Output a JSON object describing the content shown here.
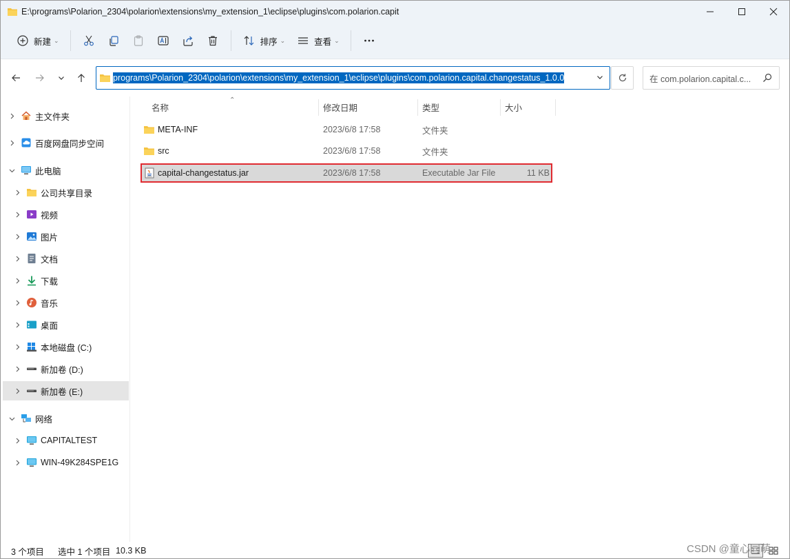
{
  "window": {
    "title": "E:\\programs\\Polarion_2304\\polarion\\extensions\\my_extension_1\\eclipse\\plugins\\com.polarion.capit",
    "controls": [
      "minimize-icon",
      "maximize-icon",
      "close-icon"
    ]
  },
  "toolbar": {
    "new_label": "新建",
    "sort_label": "排序",
    "view_label": "查看",
    "icons": [
      "cut-icon",
      "copy-icon",
      "paste-icon",
      "rename-icon",
      "share-icon",
      "delete-icon",
      "more-icon"
    ]
  },
  "address": {
    "path": "programs\\Polarion_2304\\polarion\\extensions\\my_extension_1\\eclipse\\plugins\\com.polarion.capital.changestatus_1.0.0",
    "search_placeholder": "在 com.polarion.capital.c..."
  },
  "sidebar": {
    "items": [
      {
        "label": "主文件夹",
        "icon": "home-icon"
      },
      {
        "label": "百度网盘同步空间",
        "icon": "cloud-sync-icon"
      },
      {
        "label": "此电脑",
        "icon": "computer-icon"
      },
      {
        "label": "公司共享目录",
        "icon": "folder-icon"
      },
      {
        "label": "视频",
        "icon": "video-icon"
      },
      {
        "label": "图片",
        "icon": "picture-icon"
      },
      {
        "label": "文档",
        "icon": "document-icon"
      },
      {
        "label": "下载",
        "icon": "download-icon"
      },
      {
        "label": "音乐",
        "icon": "music-icon"
      },
      {
        "label": "桌面",
        "icon": "desktop-icon"
      },
      {
        "label": "本地磁盘 (C:)",
        "icon": "drive-c-icon"
      },
      {
        "label": "新加卷 (D:)",
        "icon": "drive-icon"
      },
      {
        "label": "新加卷 (E:)",
        "icon": "drive-icon"
      },
      {
        "label": "网络",
        "icon": "network-icon"
      },
      {
        "label": "CAPITALTEST",
        "icon": "monitor-icon"
      },
      {
        "label": "WIN-49K284SPE1G",
        "icon": "monitor-icon"
      }
    ]
  },
  "columns": {
    "name": "名称",
    "modified": "修改日期",
    "type": "类型",
    "size": "大小"
  },
  "files": [
    {
      "name": "META-INF",
      "modified": "2023/6/8 17:58",
      "type": "文件夹",
      "size": "",
      "icon": "folder-icon"
    },
    {
      "name": "src",
      "modified": "2023/6/8 17:58",
      "type": "文件夹",
      "size": "",
      "icon": "folder-icon"
    },
    {
      "name": "capital-changestatus.jar",
      "modified": "2023/6/8 17:58",
      "type": "Executable Jar File",
      "size": "11 KB",
      "icon": "jar-file-icon"
    }
  ],
  "status": {
    "item_count": "3 个项目",
    "selected": "选中 1 个项目",
    "selected_size": "10.3 KB"
  },
  "watermark": "CSDN @童心同萌",
  "colors": {
    "accent": "#0067c0",
    "highlight_border": "#e02a30",
    "folder": "#f5c342"
  }
}
